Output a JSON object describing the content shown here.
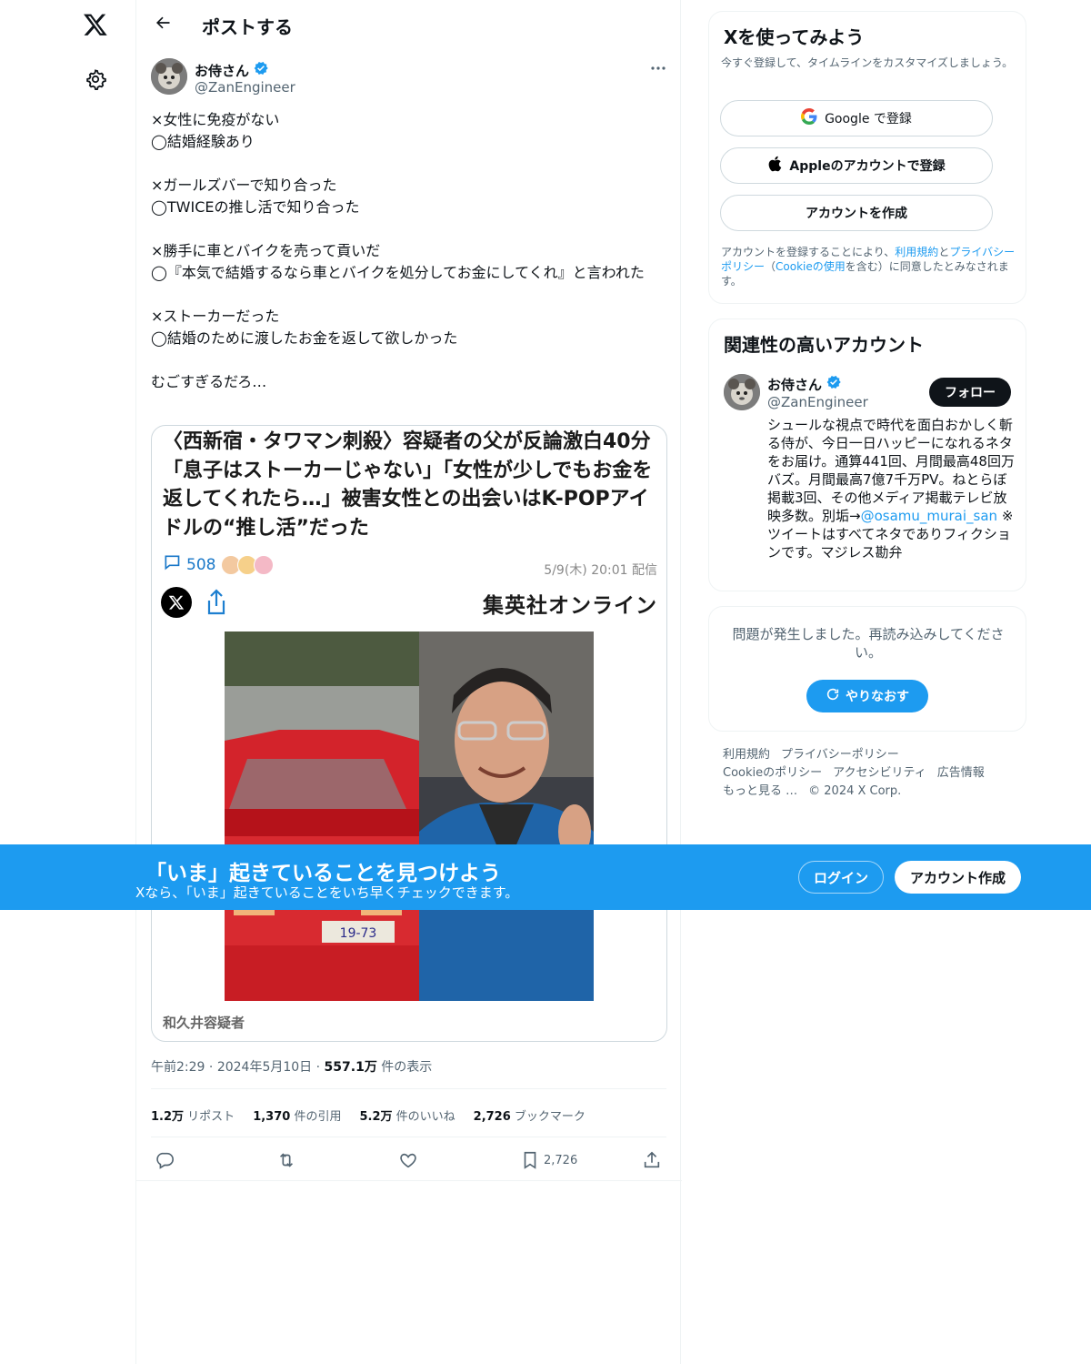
{
  "header": {
    "title": "ポストする"
  },
  "tweet": {
    "author_name": "お侍さん",
    "author_handle": "@ZanEngineer",
    "text_lines": [
      "×女性に免疫がない\n◯結婚経験あり",
      "×ガールズバーで知り合った\n◯TWICEの推し活で知り合った",
      "×勝手に車とバイクを売って貢いだ\n◯『本気で結婚するなら車とバイクを処分してお金にしてくれ』と言われた",
      "×ストーカーだった\n◯結婚のために渡したお金を返して欲しかった",
      "むごすぎるだろ…"
    ],
    "card": {
      "headline": "〈西新宿・タワマン刺殺〉容疑者の父が反論激白40分「息子はストーカーじゃない」「女性が少しでもお金を返してくれたら…」被害女性との出会いはK-POPアイドルの“推し活”だった",
      "comment_count": "508",
      "date": "5/9(木) 20:01 配信",
      "publisher": "集英社オンライン",
      "plate": "19-73",
      "caption": "和久井容疑者"
    },
    "time": "午前2:29",
    "date": "2024年5月10日",
    "views_value": "557.1万",
    "views_label": "件の表示",
    "stats": {
      "reposts_value": "1.2万",
      "reposts_label": "リポスト",
      "quotes_value": "1,370",
      "quotes_label": "件の引用",
      "likes_value": "5.2万",
      "likes_label": "件のいいね",
      "bookmarks_value": "2,726",
      "bookmarks_label": "ブックマーク"
    },
    "action_bookmark_count": "2,726"
  },
  "signup": {
    "title": "Xを使ってみよう",
    "subtitle": "今すぐ登録して、タイムラインをカスタマイズしましょう。",
    "google_label": "Google で登録",
    "apple_label": "Appleのアカウントで登録",
    "create_label": "アカウントを作成",
    "legal_prefix": "アカウントを登録することにより、",
    "legal_terms": "利用規約",
    "legal_and": "と",
    "legal_privacy": "プライバシーポリシー",
    "legal_open": "（",
    "legal_cookie": "Cookieの使用",
    "legal_suffix": "を含む）に同意したとみなされます。"
  },
  "related": {
    "title": "関連性の高いアカウント",
    "name": "お侍さん",
    "handle": "@ZanEngineer",
    "follow_label": "フォロー",
    "bio_1": "シュールな視点で時代を面白おかしく斬る侍が、今日一日ハッピーになれるネタをお届け。通算441回、月間最高48回万バズ。月間最高7億7千万PV。ねとらぼ掲載3回、その他メディア掲載テレビ放映多数。別垢→",
    "bio_link": "@osamu_murai_san",
    "bio_2": " ※ツイートはすべてネタでありフィクションです。マジレス勘弁"
  },
  "error_panel": {
    "message": "問題が発生しました。再読み込みしてください。",
    "retry_label": "やりなおす"
  },
  "footer": {
    "terms": "利用規約",
    "privacy": "プライバシーポリシー",
    "cookie": "Cookieのポリシー",
    "accessibility": "アクセシビリティ",
    "ads": "広告情報",
    "more": "もっと見る …",
    "copyright": "© 2024 X Corp."
  },
  "bottom_bar": {
    "title": "「いま」起きていることを見つけよう",
    "subtitle": "Xなら、「いま」起きていることをいち早くチェックできます。",
    "login_label": "ログイン",
    "signup_label": "アカウント作成"
  },
  "colors": {
    "accent": "#1d9bf0",
    "text": "#0f1419",
    "muted": "#536471",
    "border": "#eff3f4"
  },
  "icons": [
    "x-logo-icon",
    "settings-icon",
    "back-arrow-icon",
    "verified-badge-icon",
    "more-icon",
    "reply-icon",
    "repost-icon",
    "like-icon",
    "bookmark-icon",
    "share-icon",
    "google-icon",
    "apple-icon",
    "refresh-icon"
  ]
}
